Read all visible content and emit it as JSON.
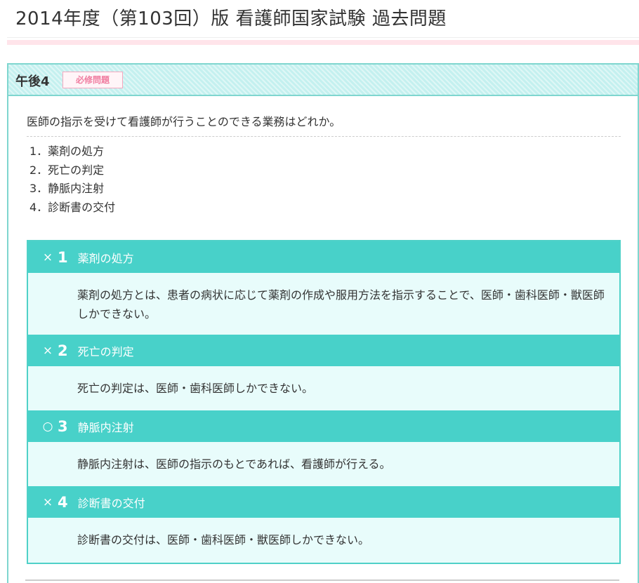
{
  "page": {
    "title": "2014年度（第103回）版 看護師国家試験 過去問題"
  },
  "question": {
    "number": "午後4",
    "badge": "必修問題",
    "text": "医師の指示を受けて看護師が行うことのできる業務はどれか。",
    "choices": [
      "1．薬剤の処方",
      "2．死亡の判定",
      "3．静脈内注射",
      "4．診断書の交付"
    ]
  },
  "explanations": [
    {
      "mark": "×",
      "number": "1",
      "title": "薬剤の処方",
      "body": "薬剤の処方とは、患者の病状に応じて薬剤の作成や服用方法を指示することで、医師・歯科医師・獣医師しかできない。"
    },
    {
      "mark": "×",
      "number": "2",
      "title": "死亡の判定",
      "body": "死亡の判定は、医師・歯科医師しかできない。"
    },
    {
      "mark": "○",
      "number": "3",
      "title": "静脈内注射",
      "body": "静脈内注射は、医師の指示のもとであれば、看護師が行える。"
    },
    {
      "mark": "×",
      "number": "4",
      "title": "診断書の交付",
      "body": "診断書の交付は、医師・歯科医師・獣医師しかできない。"
    }
  ],
  "colors": {
    "header_bg": "#c4f0ef",
    "border": "#7fd6cf",
    "explanation_header": "#48d1c9",
    "explanation_body": "#e8fcfb",
    "badge_text": "#f07da0",
    "title_accent": "#ffe4ea"
  }
}
